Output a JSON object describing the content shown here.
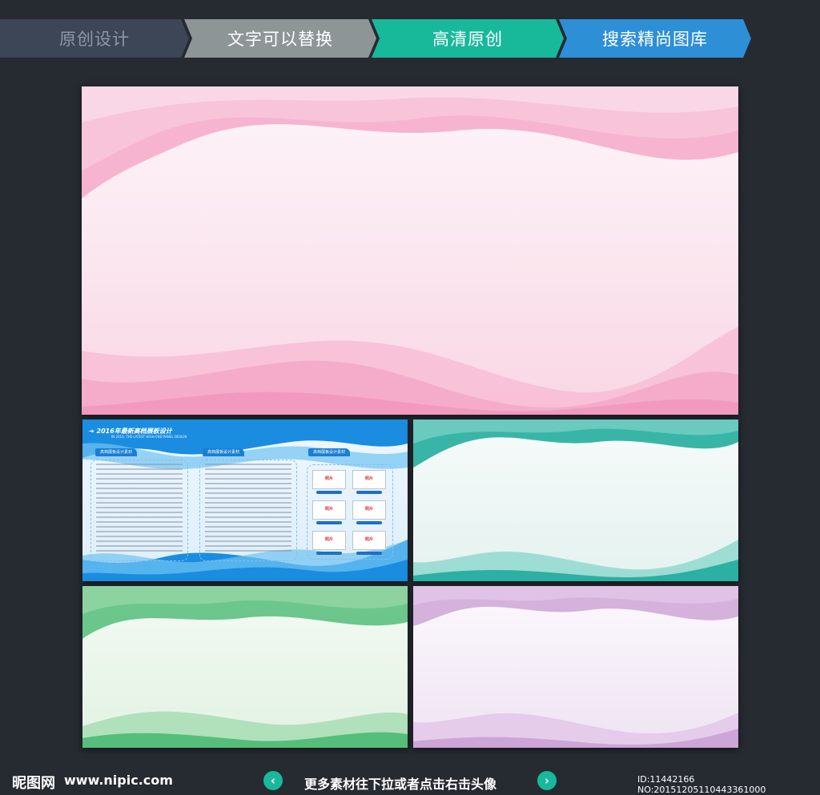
{
  "tabs": [
    {
      "label": "原创设计"
    },
    {
      "label": "文字可以替换"
    },
    {
      "label": "高清原创"
    },
    {
      "label": "搜索精尚图库"
    }
  ],
  "blue_preview": {
    "title": "2016年最新高档展板设计",
    "subtitle": "IN 2016, THE LATEST HIGH-END PANEL DESIGN",
    "section_labels": [
      "高档展板设计素材",
      "高档展板设计素材",
      "高档展板设计素材"
    ],
    "photo_label": "照片"
  },
  "footer": {
    "logo": "昵图网",
    "url": "www.nipic.com",
    "prev_icon": "‹",
    "next_icon": "›",
    "more_text": "更多素材往下拉或者点击右击头像",
    "id_text": "ID:11442166 NO:20151205110443361000"
  },
  "colors": {
    "pink": "#f08cb8",
    "blue": "#1a8de0",
    "teal": "#18a89a",
    "green": "#3fb56a",
    "purple": "#c79bd1"
  }
}
